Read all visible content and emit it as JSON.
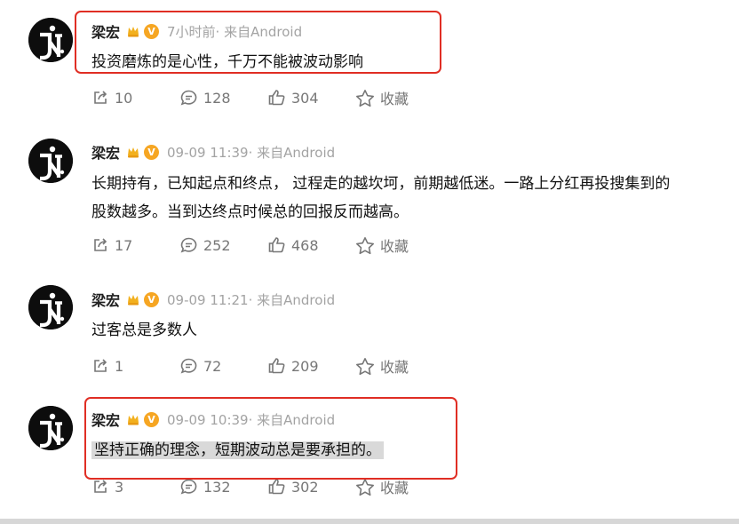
{
  "posts": [
    {
      "author": "梁宏",
      "time": "7小时前· 来自Android",
      "text": "投资磨炼的是心性，千万不能被波动影响",
      "text2": "",
      "repost": "10",
      "comment": "128",
      "like": "304",
      "favorite": "收藏"
    },
    {
      "author": "梁宏",
      "time": "09-09 11:39· 来自Android",
      "text": "长期持有，已知起点和终点， 过程走的越坎坷，前期越低迷。一路上分红再投搜集到的",
      "text2": "股数越多。当到达终点时候总的回报反而越高。",
      "repost": "17",
      "comment": "252",
      "like": "468",
      "favorite": "收藏"
    },
    {
      "author": "梁宏",
      "time": "09-09 11:21· 来自Android",
      "text": "过客总是多数人",
      "text2": "",
      "repost": "1",
      "comment": "72",
      "like": "209",
      "favorite": "收藏"
    },
    {
      "author": "梁宏",
      "time": "09-09 10:39· 来自Android",
      "text": "坚持正确的理念，短期波动总是要承担的。",
      "text2": "",
      "repost": "3",
      "comment": "132",
      "like": "302",
      "favorite": "收藏"
    }
  ],
  "colors": {
    "highlight_box": "#e02e24",
    "badge": "#f6a623",
    "meta_text": "#a3a3a3"
  },
  "icons": [
    "repost-icon",
    "comment-icon",
    "like-icon",
    "star-icon",
    "crown-badge-icon",
    "verified-v-icon"
  ]
}
